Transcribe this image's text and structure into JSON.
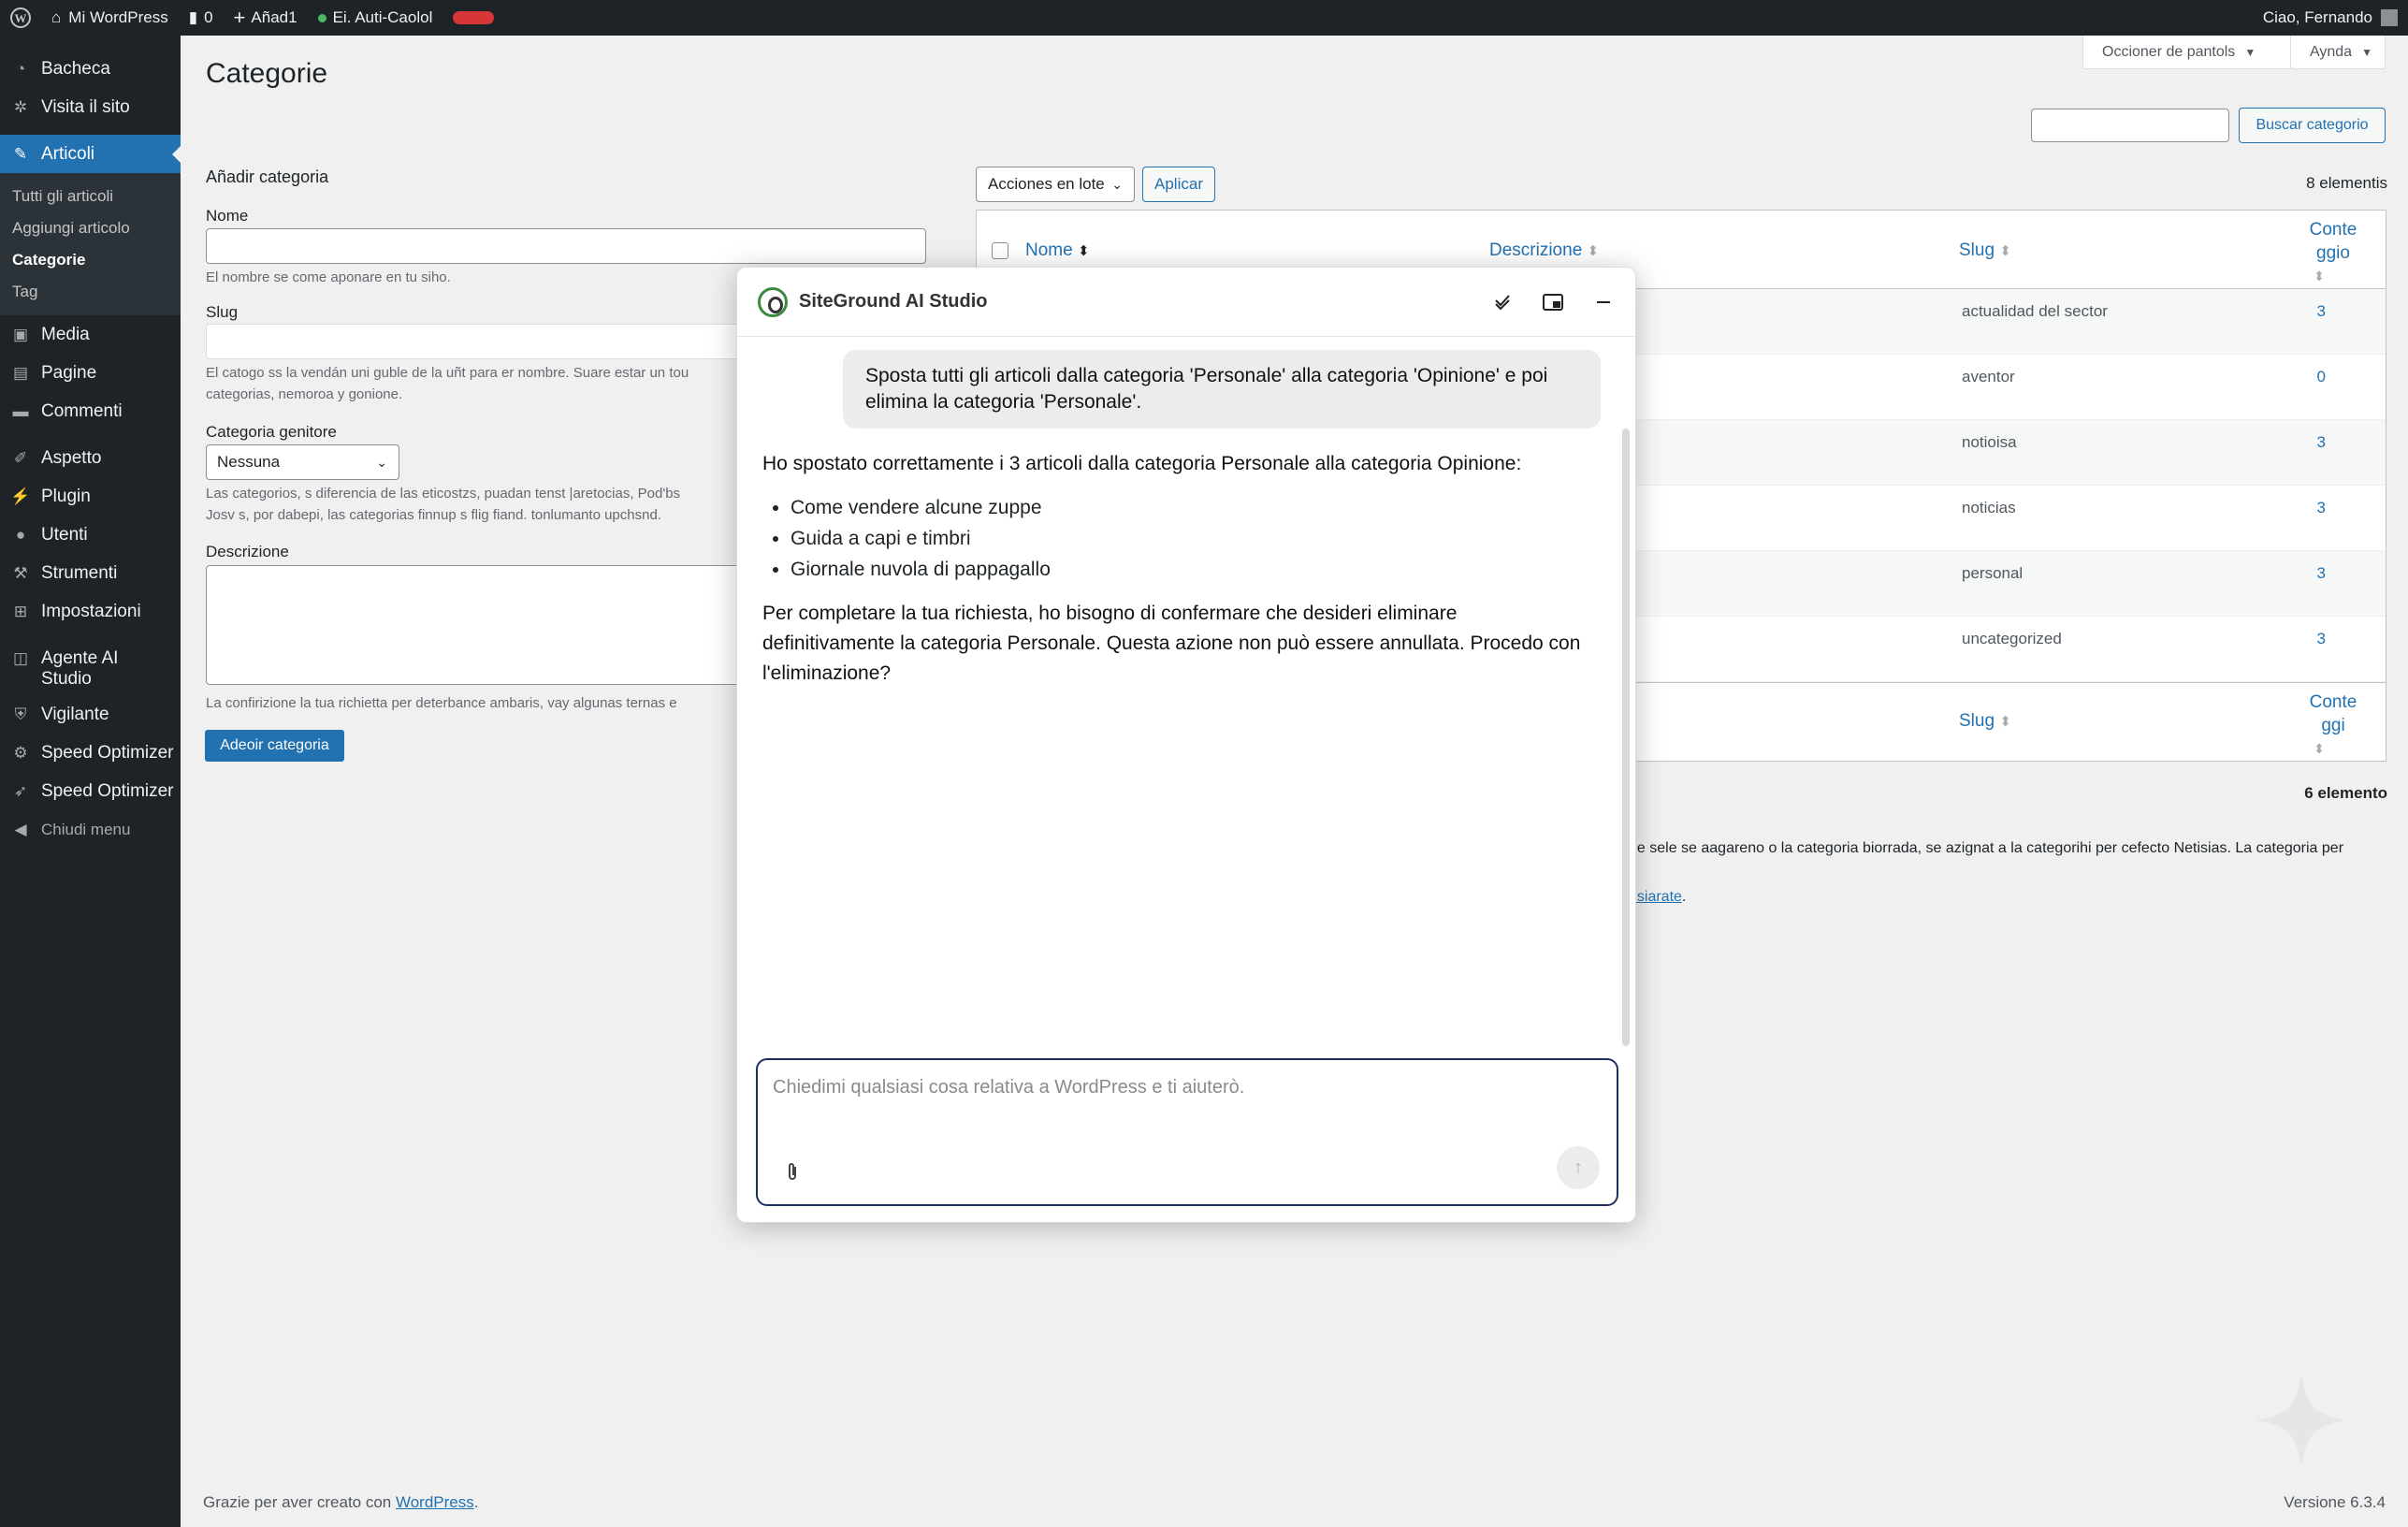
{
  "adminbar": {
    "site_name": "Mi WordPress",
    "comments": "0",
    "new_label": "Añad1",
    "plugin_item": "Ei. Auti-Caolol",
    "user_greeting": "Ciao, Fernando"
  },
  "sidebar": {
    "dashboard": "Bacheca",
    "visit_site": "Visita il sito",
    "posts": "Articoli",
    "posts_sub": [
      "Tutti gli articoli",
      "Aggiungi articolo",
      "Categorie",
      "Tag"
    ],
    "media": "Media",
    "pages": "Pagine",
    "comments": "Commenti",
    "appearance": "Aspetto",
    "plugins": "Plugin",
    "users": "Utenti",
    "tools": "Strumenti",
    "settings": "Impostazioni",
    "ai_agent": "Agente AI Studio",
    "security": "Vigilante",
    "speed1": "Speed Optimizer",
    "speed2": "Speed Optimizer",
    "collapse": "Chiudi menu"
  },
  "header": {
    "title": "Categorie",
    "screen_options": "Occioner de pantols",
    "help": "Aynda",
    "search_button": "Buscar categorio"
  },
  "form": {
    "title": "Añadir categoria",
    "name_label": "Nome",
    "name_hint": "El nombre se come aponare en tu siho.",
    "slug_label": "Slug",
    "slug_hint_1": "El catogo ss la vendán uni guble de la uñt para er nombre. Suare estar un tou",
    "slug_hint_2": "categorias, nemoroa y gonione.",
    "parent_label": "Categoria genitore",
    "parent_value": "Nessuna",
    "parent_hint_1": "Las categorios, s diferencia de las eticostzs, puadan tenst |aretocias, Pod'bs",
    "parent_hint_2": "Josv s, por dabepi, las categorias finnup s flig fiand. tonlumanto upchsnd.",
    "desc_label": "Descrizione",
    "desc_hint": "La confirizione la tua richietta per deterbance ambaris, vay algunas ternas e",
    "submit": "Adeoir categoria"
  },
  "table": {
    "bulk_label": "Acciones en lote",
    "apply": "Aplicar",
    "count_top": "8 elementis",
    "count_bottom": "6 elemento",
    "col_name": "Nome",
    "col_desc": "Descrizione",
    "col_slug": "Slug",
    "col_count_1": "Conte",
    "col_count_2": "ggio",
    "foot_count_1": "Conte",
    "foot_count_2": "ggi",
    "rows": [
      {
        "slug": "actualidad del sector",
        "count": "3"
      },
      {
        "slug": "aventor",
        "count": "0"
      },
      {
        "slug": "notioisa",
        "count": "3"
      },
      {
        "slug": "noticias",
        "count": "3"
      },
      {
        "slug": "personal",
        "count": "3"
      },
      {
        "slug": "uncategorized",
        "count": "3"
      }
    ],
    "note_1": "ue sele se aagareno o la categoria biorrada, se azignat a la categorihi per cefecto Netisias. La categoria per",
    "note_link": "nsiarate"
  },
  "footer": {
    "thanks_prefix": "Grazie per aver creato con ",
    "thanks_link": "WordPress",
    "thanks_suffix": ".",
    "version": "Versione 6.3.4"
  },
  "ai": {
    "title": "SiteGround AI Studio",
    "user_msg": "Sposta tutti gli articoli dalla categoria 'Personale' alla categoria 'Opinione' e poi elimina la categoria 'Personale'.",
    "reply_intro": "Ho spostato correttamente i 3 articoli dalla categoria Personale alla categoria Opinione:",
    "moved": [
      "Come vendere alcune zuppe",
      "Guida a capi e timbri",
      "Giornale nuvola di pappagallo"
    ],
    "reply_confirm": "Per completare la tua richiesta, ho bisogno di confermare che desideri eliminare definitivamente la categoria Personale. Questa azione non può essere annullata. Procedo con l'eliminazione?",
    "input_placeholder": "Chiedimi qualsiasi cosa relativa a WordPress e ti aiuterò."
  }
}
